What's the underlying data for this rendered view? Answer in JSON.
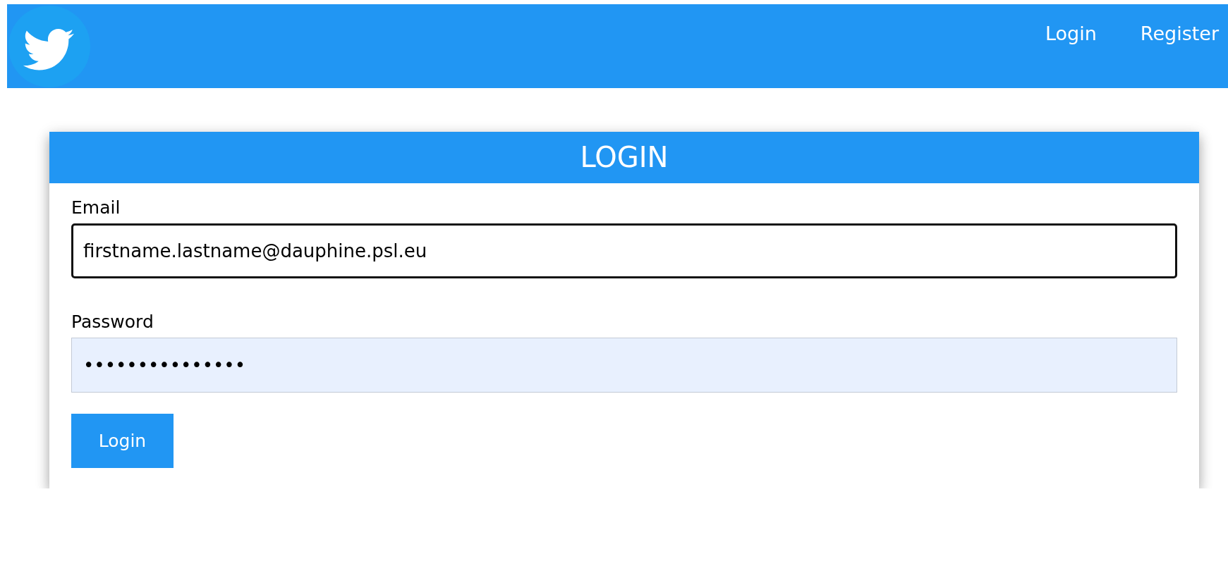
{
  "navbar": {
    "links": [
      {
        "label": "Login"
      },
      {
        "label": "Register"
      }
    ]
  },
  "card": {
    "title": "LOGIN",
    "fields": [
      {
        "label": "Email",
        "value": "firstname.lastname@dauphine.psl.eu",
        "focused": true,
        "autofilled": false
      },
      {
        "label": "Password",
        "value": "•••••••••••••••",
        "focused": false,
        "autofilled": true
      }
    ],
    "button": "Login"
  }
}
